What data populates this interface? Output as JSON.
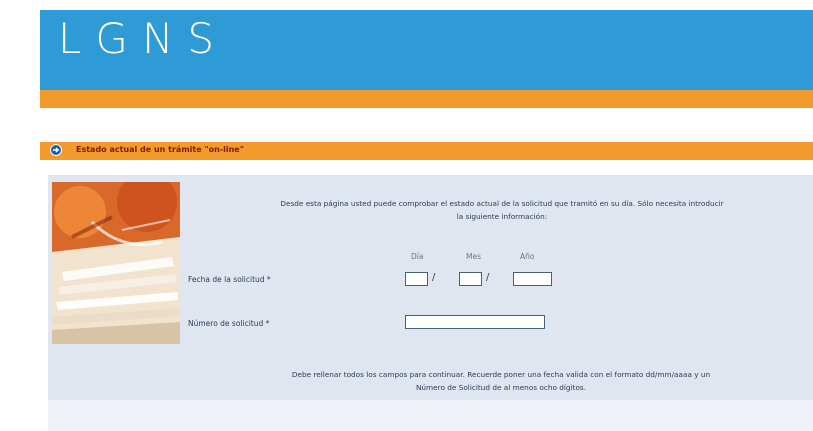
{
  "header": {
    "logo_text": "LGNS",
    "colors": {
      "primary_blue": "#2e9bd6",
      "accent_orange": "#f39a2d",
      "panel": "#dfe6ef"
    }
  },
  "section": {
    "icon": "arrow-right-circle-icon",
    "title": "Estado actual de un trámite \"on-line\""
  },
  "content": {
    "illustration": "documents-photo",
    "intro_line1": "Desde esta página usted puede comprobar el estado actual de la solicitud que tramitó en su día. Sólo necesita introducir",
    "intro_line2": "la siguiente información:",
    "date_labels": {
      "day": "Día",
      "month": "Mes",
      "year": "Año"
    },
    "fecha_label": "Fecha de la solicitud *",
    "separator": "/",
    "numero_label": "Número de solicitud *",
    "inputs": {
      "day": "",
      "month": "",
      "year": "",
      "numero": ""
    },
    "footer_line1": "Debe rellenar todos los campos para continuar. Recuerde poner una fecha valida con el formato dd/mm/aaaa y un",
    "footer_line2": "Número de Solicitud de al menos ocho dígitos."
  }
}
